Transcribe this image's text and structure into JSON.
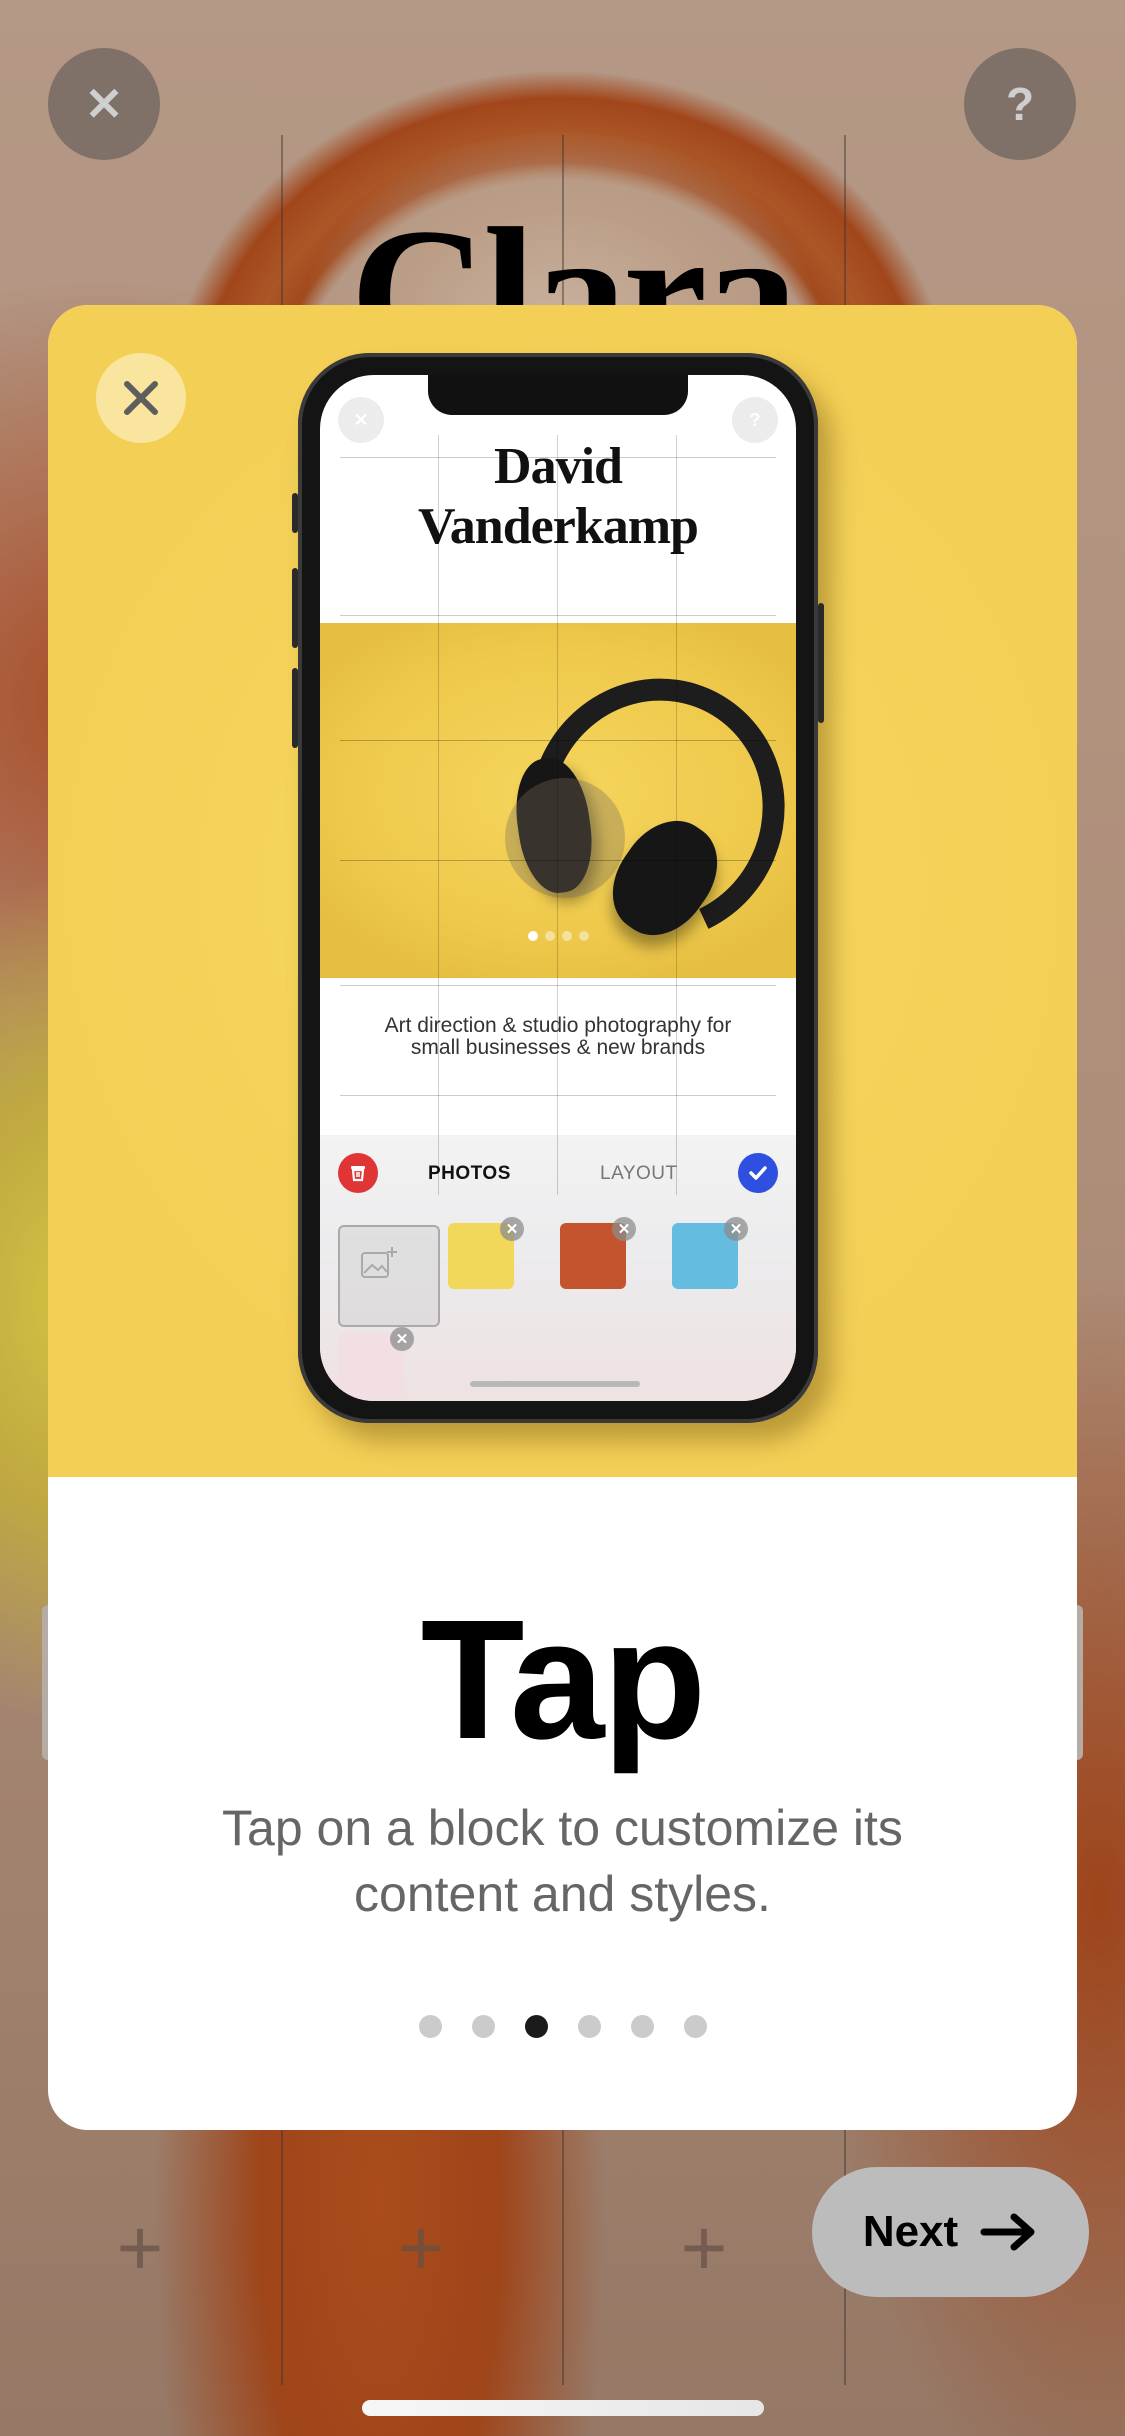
{
  "background": {
    "title": "Clara",
    "close_icon": "close-icon",
    "help_icon": "help-icon",
    "add_icon": "plus-icon"
  },
  "top_bar": {
    "close_label": "✕",
    "help_label": "?"
  },
  "onboarding_card": {
    "close_label": "close",
    "phone_preview": {
      "site_title_line1": "David",
      "site_title_line2": "Vanderkamp",
      "tagline_line1": "Art direction & studio photography for",
      "tagline_line2": "small businesses & new brands",
      "photo_carousel": {
        "count": 4,
        "active_index": 0
      },
      "editor": {
        "tabs": [
          {
            "label": "PHOTOS",
            "active": true
          },
          {
            "label": "LAYOUT",
            "active": false
          }
        ],
        "thumbnails": [
          {
            "name": "headphones",
            "color": "#f1d75a"
          },
          {
            "name": "records",
            "color": "#c4542e"
          },
          {
            "name": "ice-cream-cone",
            "color": "#64bde0"
          },
          {
            "name": "pink-splash",
            "color": "#f1dfe3"
          }
        ]
      }
    },
    "heading": "Tap",
    "description": "Tap on a block to customize its content and styles.",
    "pager": {
      "total": 6,
      "active_index": 2
    }
  },
  "next_button": {
    "label": "Next"
  },
  "colors": {
    "hero_yellow": "#f5d35a",
    "editor_delete": "#e03535",
    "editor_confirm": "#2f4fe0",
    "pager_active": "#1b1b1b",
    "pager_inactive": "#cbcbcb"
  }
}
